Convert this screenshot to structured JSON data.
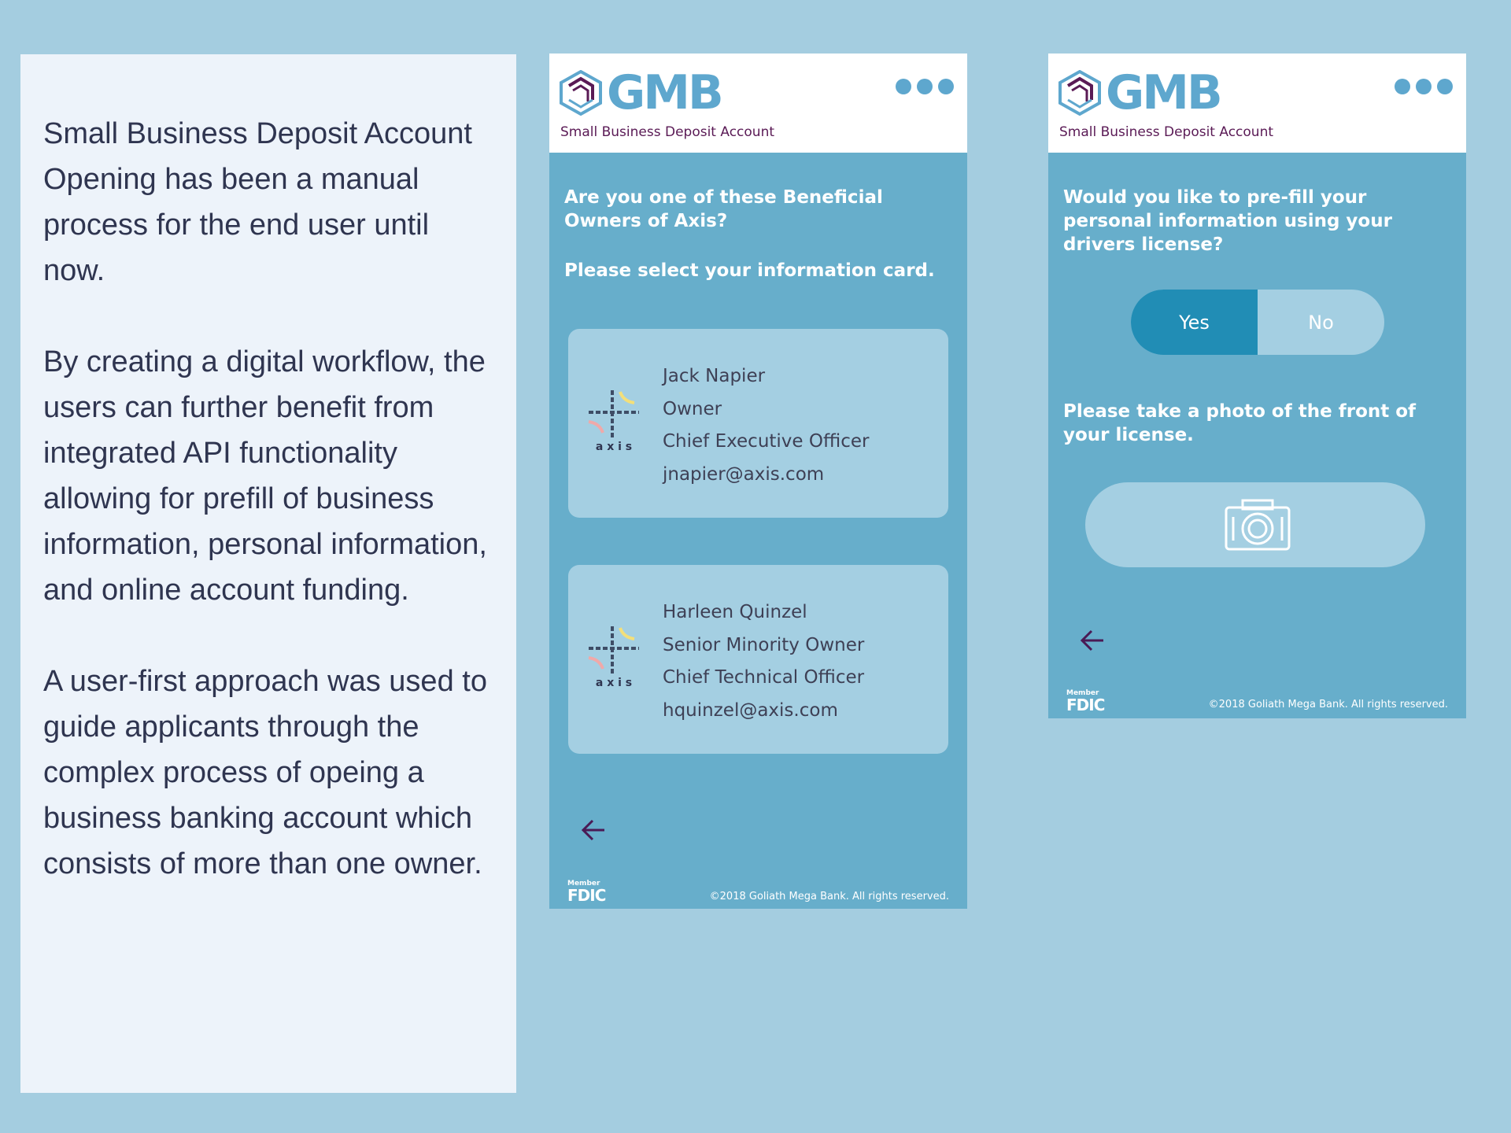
{
  "intro": {
    "paragraphs": [
      "Small Business Deposit Account Opening has been a manual process for the end user until now.",
      "By creating a digital workflow, the users can further benefit from integrated API functionality allowing for prefill of business information, personal information, and online account funding.",
      "A user-first approach was used to guide applicants through the complex process of opeing a business banking account which consists of more than one owner."
    ]
  },
  "brand": {
    "logo_text": "GMB",
    "subtitle": "Small Business Deposit Account",
    "logo_color": "#5ea7ce",
    "subtitle_color": "#5a1a55"
  },
  "screen1": {
    "question": "Are you one of these Beneficial Owners of Axis?",
    "instruction": "Please select your information card.",
    "cards": [
      {
        "company_logo_text": "a x i s",
        "name": "Jack Napier",
        "role": "Owner",
        "title": "Chief Executive Officer",
        "email": "jnapier@axis.com"
      },
      {
        "company_logo_text": "a x i s",
        "name": "Harleen Quinzel",
        "role": "Senior Minority Owner",
        "title": "Chief Technical Officer",
        "email": "hquinzel@axis.com"
      }
    ]
  },
  "screen2": {
    "question": "Would you like to pre-fill your personal information using your drivers license?",
    "toggle": {
      "yes": "Yes",
      "no": "No",
      "selected": "Yes"
    },
    "photo_prompt": "Please take a photo of the front of your license."
  },
  "footer": {
    "member": "Member",
    "fdic": "FDIC",
    "copyright": "©2018 Goliath Mega Bank. All rights reserved."
  },
  "colors": {
    "page_bg": "#a4cde0",
    "panel_bg": "#edf3fa",
    "phone_bg": "#67aecb",
    "card_bg": "#a4cfe2",
    "toggle_selected": "#218db5",
    "arrow": "#4a1a55"
  }
}
